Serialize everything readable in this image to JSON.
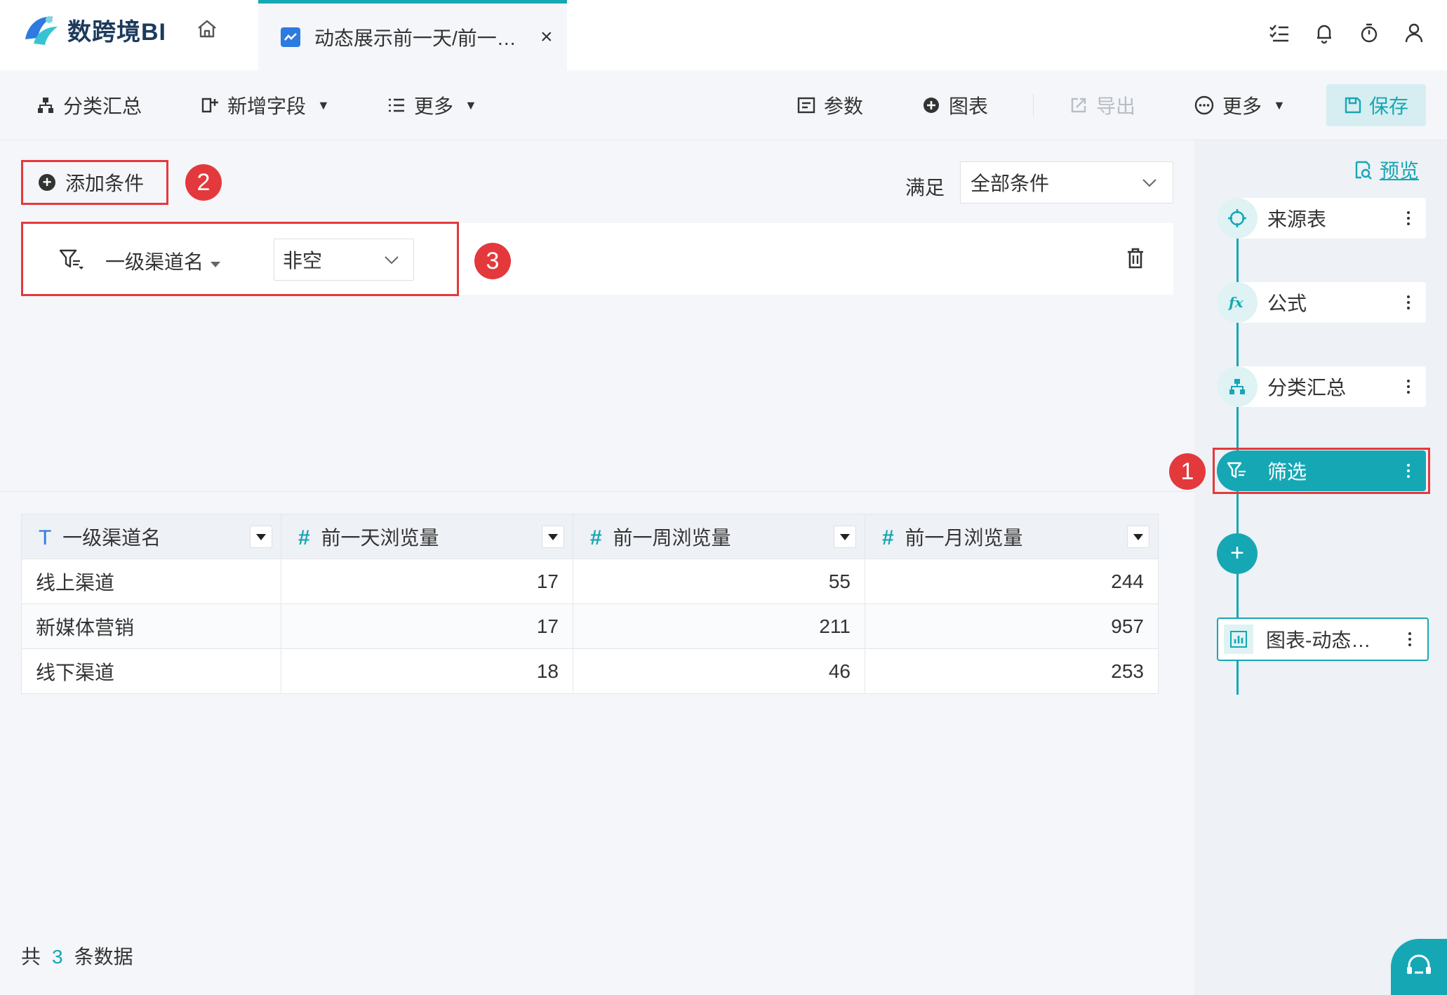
{
  "app": {
    "name": "数跨境BI"
  },
  "tab": {
    "title": "动态展示前一天/前一…",
    "close": "×"
  },
  "toolbar": {
    "group_summary": "分类汇总",
    "add_field": "新增字段",
    "more_left": "更多",
    "params": "参数",
    "chart": "图表",
    "export": "导出",
    "more_right": "更多",
    "save": "保存"
  },
  "filter": {
    "add_condition": "添加条件",
    "satisfy_label": "满足",
    "satisfy_value": "全部条件",
    "condition": {
      "field": "一级渠道名",
      "operator": "非空"
    }
  },
  "annotations": {
    "b1": "1",
    "b2": "2",
    "b3": "3"
  },
  "table": {
    "columns": [
      {
        "type": "T",
        "label": "一级渠道名"
      },
      {
        "type": "#",
        "label": "前一天浏览量"
      },
      {
        "type": "#",
        "label": "前一周浏览量"
      },
      {
        "type": "#",
        "label": "前一月浏览量"
      }
    ],
    "rows": [
      [
        "线上渠道",
        "17",
        "55",
        "244"
      ],
      [
        "新媒体营销",
        "17",
        "211",
        "957"
      ],
      [
        "线下渠道",
        "18",
        "46",
        "253"
      ]
    ],
    "count_prefix": "共",
    "count": "3",
    "count_suffix": "条数据"
  },
  "flow": {
    "preview": "预览",
    "nodes": [
      "来源表",
      "公式",
      "分类汇总",
      "筛选"
    ],
    "add": "+",
    "chart_node": "图表-动态…"
  },
  "colors": {
    "accent": "#16a7b5",
    "annotation": "#e4393c",
    "panel": "#f4f6f9"
  }
}
